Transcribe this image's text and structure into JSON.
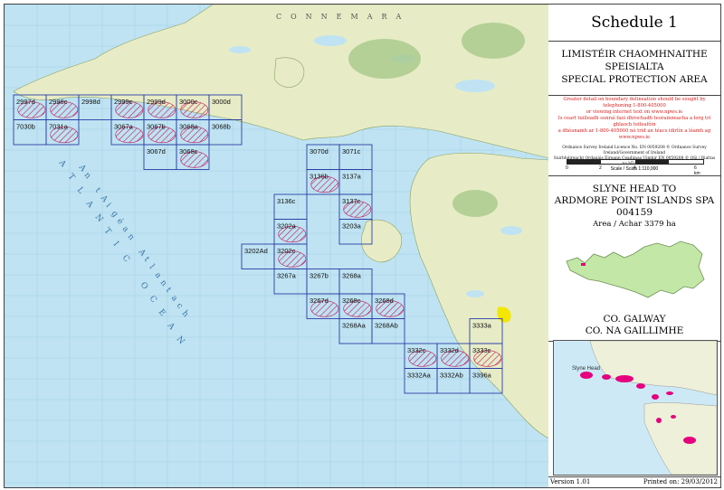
{
  "schedule_title": "Schedule 1",
  "designation": {
    "irish": [
      "LIMISTÉIR CHAOMHNAITHE",
      "SPEISIALTA"
    ],
    "english": "SPECIAL PROTECTION AREA"
  },
  "disclaimer": {
    "red_lines": [
      "Greater detail on boundary delineation should be sought by telephoning 1-800-405000",
      "or viewing internet text on www.npws.ie",
      "Is ceart tuilleadh sonraí faoi dhrochadh teorainneacha a lorg trí ghlaoch teileafóin",
      "a dhéanamh ar 1-800-405000 nó tríd an téacs idirlín a léamh ag www.npws.ie"
    ],
    "black_lines": [
      "Ordnance Survey Ireland Licence No. EN 0059208 © Ordnance Survey Ireland/Government of Ireland",
      "Suirbhéireacht Ordanáis Éireann Ceadúnas Uimhir EN 0059208 © OSi / Rialtas na hÉireann"
    ]
  },
  "scale": {
    "ticks": [
      "0",
      "2",
      "4",
      "6 km"
    ],
    "label": "Scale / Scála 1:110,000"
  },
  "site": {
    "name_lines": [
      "SLYNE HEAD TO",
      "ARDMORE POINT ISLANDS SPA"
    ],
    "code": "004159",
    "area": "Area / Achar  3379 ha"
  },
  "county": [
    "CO. GALWAY",
    "CO. NA GAILLIMHE"
  ],
  "version": "Version 1.01",
  "printed": "Printed on: 29/03/2012",
  "map": {
    "sea_label": "ATLANTIC OCEAN",
    "irish_sea_label": "An tAigéan Atlantach",
    "region_label": "CONNEMARA",
    "sheets": [
      {
        "id": "2997d",
        "col": 0,
        "row": 0,
        "hatched": true
      },
      {
        "id": "2998c",
        "col": 1,
        "row": 0,
        "hatched": true
      },
      {
        "id": "2998d",
        "col": 2,
        "row": 0,
        "hatched": false
      },
      {
        "id": "7030b",
        "col": 0,
        "row": 1,
        "hatched": false
      },
      {
        "id": "7031a",
        "col": 1,
        "row": 1,
        "hatched": true
      },
      {
        "id": "2999c",
        "col": 3,
        "row": 0,
        "hatched": true
      },
      {
        "id": "2999d",
        "col": 4,
        "row": 0,
        "hatched": true
      },
      {
        "id": "3000c",
        "col": 5,
        "row": 0,
        "hatched": true
      },
      {
        "id": "3000d",
        "col": 6,
        "row": 0,
        "hatched": false
      },
      {
        "id": "3067a",
        "col": 3,
        "row": 1,
        "hatched": true
      },
      {
        "id": "3067b",
        "col": 4,
        "row": 1,
        "hatched": true
      },
      {
        "id": "3068a",
        "col": 5,
        "row": 1,
        "hatched": true
      },
      {
        "id": "3068b",
        "col": 6,
        "row": 1,
        "hatched": false
      },
      {
        "id": "3067d",
        "col": 4,
        "row": 2,
        "hatched": false
      },
      {
        "id": "3068c",
        "col": 5,
        "row": 2,
        "hatched": true
      },
      {
        "id": "3070d",
        "col": 9,
        "row": 2,
        "hatched": false
      },
      {
        "id": "3071c",
        "col": 10,
        "row": 2,
        "hatched": false
      },
      {
        "id": "3136b",
        "col": 9,
        "row": 3,
        "hatched": true
      },
      {
        "id": "3137a",
        "col": 10,
        "row": 3,
        "hatched": false
      },
      {
        "id": "3136c",
        "col": 8,
        "row": 4,
        "hatched": false
      },
      {
        "id": "3137c",
        "col": 10,
        "row": 4,
        "hatched": true
      },
      {
        "id": "3202a",
        "col": 8,
        "row": 5,
        "hatched": true
      },
      {
        "id": "3203a",
        "col": 10,
        "row": 5,
        "hatched": false
      },
      {
        "id": "3202Ad",
        "col": 7,
        "row": 6,
        "hatched": false
      },
      {
        "id": "3202c",
        "col": 8,
        "row": 6,
        "hatched": true
      },
      {
        "id": "3267a",
        "col": 8,
        "row": 7,
        "hatched": false
      },
      {
        "id": "3267b",
        "col": 9,
        "row": 7,
        "hatched": false
      },
      {
        "id": "3268a",
        "col": 10,
        "row": 7,
        "hatched": false
      },
      {
        "id": "3267d",
        "col": 9,
        "row": 8,
        "hatched": true
      },
      {
        "id": "3268c",
        "col": 10,
        "row": 8,
        "hatched": true
      },
      {
        "id": "3268d",
        "col": 11,
        "row": 8,
        "hatched": true
      },
      {
        "id": "3268Aa",
        "col": 10,
        "row": 9,
        "hatched": false
      },
      {
        "id": "3268Ab",
        "col": 11,
        "row": 9,
        "hatched": false
      },
      {
        "id": "3333a",
        "col": 14,
        "row": 9,
        "hatched": false
      },
      {
        "id": "3332c",
        "col": 12,
        "row": 10,
        "hatched": true
      },
      {
        "id": "3332d",
        "col": 13,
        "row": 10,
        "hatched": true
      },
      {
        "id": "3333c",
        "col": 14,
        "row": 10,
        "hatched": true
      },
      {
        "id": "3332Aa",
        "col": 12,
        "row": 11,
        "hatched": false
      },
      {
        "id": "3332Ab",
        "col": 13,
        "row": 11,
        "hatched": false
      },
      {
        "id": "3396a",
        "col": 14,
        "row": 11,
        "hatched": false
      }
    ]
  },
  "inset_map_labels": [
    "Slyne Head"
  ],
  "colors": {
    "sea": "#bfe3f2",
    "land": "#e7ecc6",
    "sheet_border": "#2c3fa6",
    "spa_hatch": "#c2185b",
    "inset_spa": "#e6007e",
    "disclaimer_red": "#d81b1b"
  }
}
